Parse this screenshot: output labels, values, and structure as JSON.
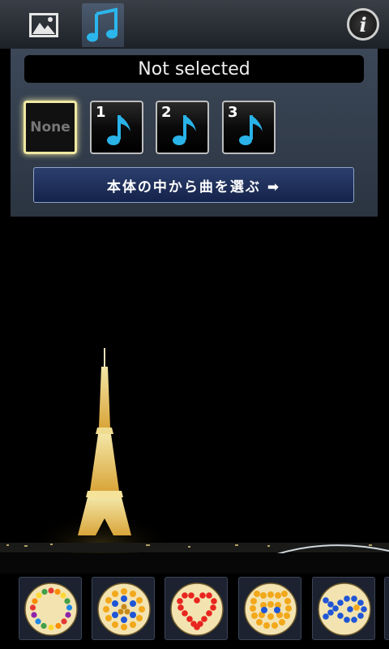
{
  "tabs": [
    {
      "icon": "image-icon"
    },
    {
      "icon": "music-note-icon"
    }
  ],
  "info_label": "i",
  "music_panel": {
    "status": "Not selected",
    "none_label": "None",
    "slots": [
      {
        "number": "1",
        "icon": "music-note-icon"
      },
      {
        "number": "2",
        "icon": "music-note-icon"
      },
      {
        "number": "3",
        "icon": "music-note-icon"
      }
    ],
    "choose_button": "本体の中から曲を選ぶ ➡"
  },
  "photo": {
    "subject": "eiffel-tower-night"
  },
  "thumbnails": [
    {
      "name": "rainbow-circle"
    },
    {
      "name": "flower"
    },
    {
      "name": "heart"
    },
    {
      "name": "smiley-face"
    },
    {
      "name": "fish"
    }
  ],
  "colors": {
    "accent": "#29b3e8",
    "bead_yellow": "#f2a81a",
    "bead_red": "#e8251f",
    "bead_blue": "#1f55d6"
  }
}
